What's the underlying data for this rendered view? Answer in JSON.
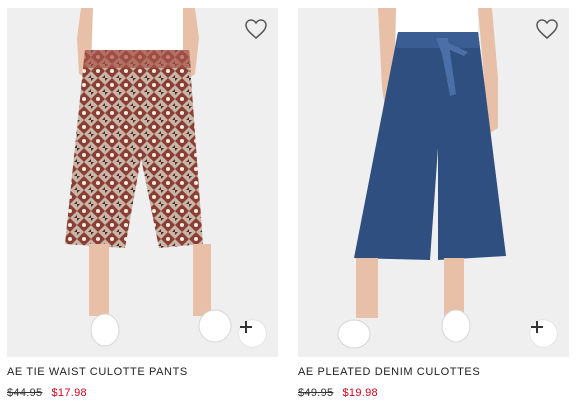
{
  "products": [
    {
      "name": "AE TIE WAIST CULOTTE PANTS",
      "original_price": "$44.95",
      "sale_price": "$17.98",
      "favorite_icon": "heart-outline-icon",
      "add_icon": "plus-icon"
    },
    {
      "name": "AE PLEATED DENIM CULOTTES",
      "original_price": "$49.95",
      "sale_price": "$19.98",
      "favorite_icon": "heart-outline-icon",
      "add_icon": "plus-icon"
    }
  ],
  "colors": {
    "sale_price": "#d0021b",
    "image_background": "#efefef",
    "denim": "#2f4f80",
    "print_base": "#c9b4a6"
  }
}
